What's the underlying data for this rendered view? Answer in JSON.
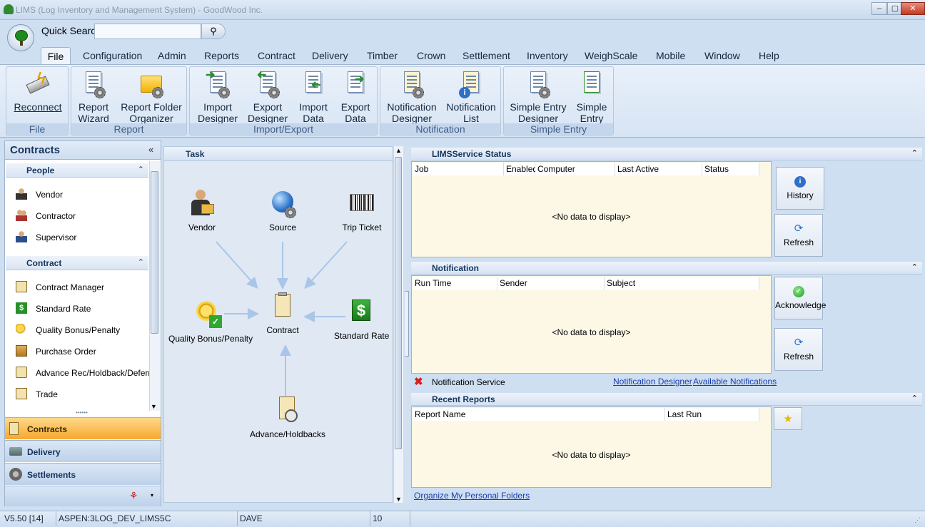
{
  "window": {
    "title": "LIMS (Log Inventory and Management System) - GoodWood Inc.",
    "minimize": "‒",
    "restore": "▢",
    "close": "✕"
  },
  "quick_search": {
    "label": "Quick Searc",
    "value": "",
    "go_icon": "binoculars-icon"
  },
  "menu": {
    "items": [
      "File",
      "Configuration",
      "Admin",
      "Reports",
      "Contract",
      "Delivery",
      "Timber",
      "Crown",
      "Settlement",
      "Inventory",
      "WeighScale",
      "Mobile",
      "Window",
      "Help"
    ],
    "active": "File"
  },
  "ribbon": {
    "groups": [
      {
        "label": "File",
        "buttons": [
          {
            "line1": "Reconnect",
            "line2": ""
          }
        ]
      },
      {
        "label": "Report",
        "buttons": [
          {
            "line1": "Report",
            "line2": "Wizard"
          },
          {
            "line1": "Report Folder",
            "line2": "Organizer"
          }
        ]
      },
      {
        "label": "Import/Export",
        "buttons": [
          {
            "line1": "Import",
            "line2": "Designer"
          },
          {
            "line1": "Export",
            "line2": "Designer"
          },
          {
            "line1": "Import",
            "line2": "Data"
          },
          {
            "line1": "Export",
            "line2": "Data"
          }
        ]
      },
      {
        "label": "Notification",
        "buttons": [
          {
            "line1": "Notification",
            "line2": "Designer"
          },
          {
            "line1": "Notification",
            "line2": "List"
          }
        ]
      },
      {
        "label": "Simple Entry",
        "buttons": [
          {
            "line1": "Simple Entry",
            "line2": "Designer"
          },
          {
            "line1": "Simple",
            "line2": "Entry"
          }
        ]
      }
    ]
  },
  "left_panel": {
    "title": "Contracts",
    "collapse_glyph": "«",
    "sections": [
      {
        "title": "People",
        "items": [
          "Vendor",
          "Contractor",
          "Supervisor"
        ]
      },
      {
        "title": "Contract",
        "items": [
          "Contract Manager",
          "Standard Rate",
          "Quality Bonus/Penalty",
          "Purchase Order",
          "Advance Rec/Holdback/Deferral",
          "Trade"
        ]
      }
    ],
    "nav": [
      "Contracts",
      "Delivery",
      "Settlements"
    ],
    "nav_active": "Contracts"
  },
  "task": {
    "title": "Task",
    "nodes": {
      "vendor": "Vendor",
      "source": "Source",
      "trip_ticket": "Trip Ticket",
      "quality": "Quality Bonus/Penalty",
      "contract": "Contract",
      "standard_rate": "Standard Rate",
      "advance": "Advance/Holdbacks"
    }
  },
  "service_status": {
    "title": "LIMSService Status",
    "columns": [
      "Job",
      "Enabled",
      "Computer",
      "Last Active",
      "Status"
    ],
    "empty": "<No data to display>",
    "buttons": [
      "History",
      "Refresh"
    ]
  },
  "notification": {
    "title": "Notification",
    "columns": [
      "Run Time",
      "Sender",
      "Subject"
    ],
    "empty": "<No data to display>",
    "buttons": [
      "Acknowledge",
      "Refresh"
    ],
    "service_label": "Notification Service",
    "links": [
      "Notification Designer",
      "Available Notifications"
    ]
  },
  "recent_reports": {
    "title": "Recent Reports",
    "columns": [
      "Report Name",
      "Last Run"
    ],
    "empty": "<No data to display>",
    "link": "Organize My Personal Folders"
  },
  "status_bar": {
    "version": "V5.50 [14]",
    "database": "ASPEN:3LOG_DEV_LIMS5C",
    "user": "DAVE",
    "count": "10"
  },
  "colors": {
    "accent": "#f6a82e",
    "header_text": "#15355e",
    "link": "#1a3da8",
    "grid_bg": "#fdf8e6"
  }
}
